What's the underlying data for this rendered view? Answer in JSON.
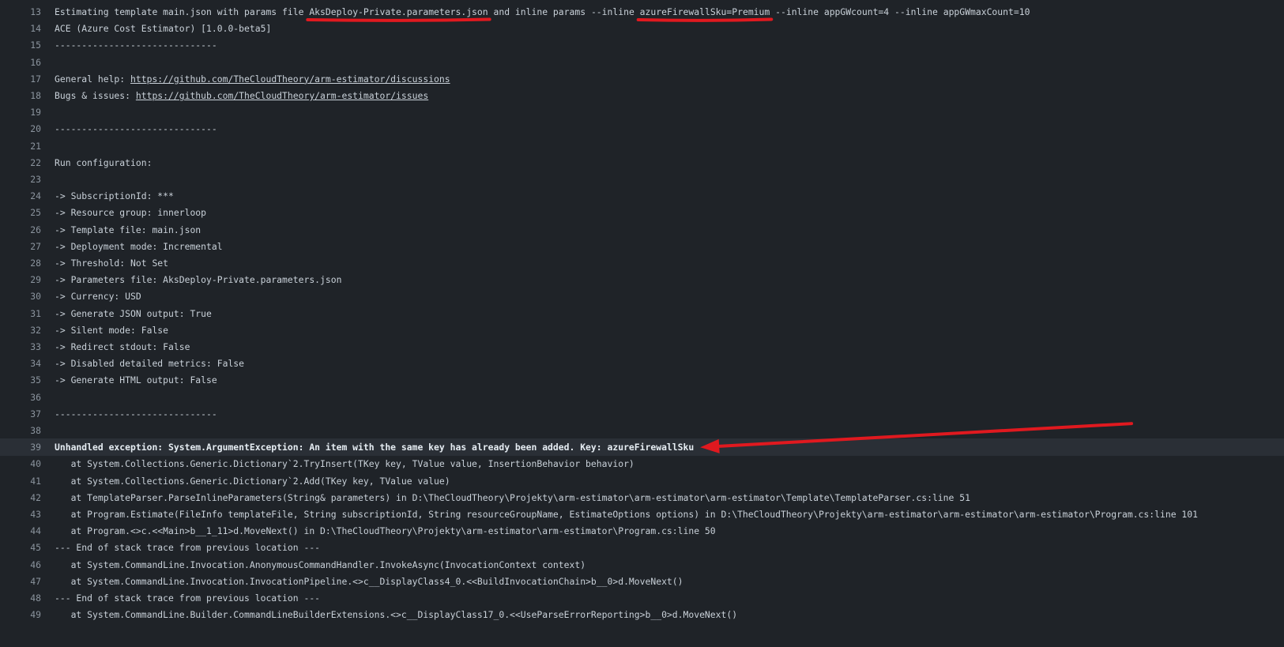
{
  "lines": [
    {
      "num": "13",
      "parts": [
        {
          "t": "Estimating template main.json with params file "
        },
        {
          "t": "AksDeploy-Private.parameters.json",
          "mark": "underline1"
        },
        {
          "t": " and inline params --inline "
        },
        {
          "t": "azureFirewallSku=Premium",
          "mark": "underline2"
        },
        {
          "t": " --inline appGWcount=4 --inline appGWmaxCount=10"
        }
      ]
    },
    {
      "num": "14",
      "parts": [
        {
          "t": "ACE (Azure Cost Estimator) [1.0.0-beta5]"
        }
      ]
    },
    {
      "num": "15",
      "parts": [
        {
          "t": "------------------------------"
        }
      ]
    },
    {
      "num": "16",
      "parts": []
    },
    {
      "num": "17",
      "parts": [
        {
          "t": "General help: "
        },
        {
          "t": "https://github.com/TheCloudTheory/arm-estimator/discussions",
          "link": true
        }
      ]
    },
    {
      "num": "18",
      "parts": [
        {
          "t": "Bugs & issues: "
        },
        {
          "t": "https://github.com/TheCloudTheory/arm-estimator/issues",
          "link": true
        }
      ]
    },
    {
      "num": "19",
      "parts": []
    },
    {
      "num": "20",
      "parts": [
        {
          "t": "------------------------------"
        }
      ]
    },
    {
      "num": "21",
      "parts": []
    },
    {
      "num": "22",
      "parts": [
        {
          "t": "Run configuration:"
        }
      ]
    },
    {
      "num": "23",
      "parts": []
    },
    {
      "num": "24",
      "parts": [
        {
          "t": "-> SubscriptionId: ***"
        }
      ]
    },
    {
      "num": "25",
      "parts": [
        {
          "t": "-> Resource group: innerloop"
        }
      ]
    },
    {
      "num": "26",
      "parts": [
        {
          "t": "-> Template file: main.json"
        }
      ]
    },
    {
      "num": "27",
      "parts": [
        {
          "t": "-> Deployment mode: Incremental"
        }
      ]
    },
    {
      "num": "28",
      "parts": [
        {
          "t": "-> Threshold: Not Set"
        }
      ]
    },
    {
      "num": "29",
      "parts": [
        {
          "t": "-> Parameters file: AksDeploy-Private.parameters.json"
        }
      ]
    },
    {
      "num": "30",
      "parts": [
        {
          "t": "-> Currency: USD"
        }
      ]
    },
    {
      "num": "31",
      "parts": [
        {
          "t": "-> Generate JSON output: True"
        }
      ]
    },
    {
      "num": "32",
      "parts": [
        {
          "t": "-> Silent mode: False"
        }
      ]
    },
    {
      "num": "33",
      "parts": [
        {
          "t": "-> Redirect stdout: False"
        }
      ]
    },
    {
      "num": "34",
      "parts": [
        {
          "t": "-> Disabled detailed metrics: False"
        }
      ]
    },
    {
      "num": "35",
      "parts": [
        {
          "t": "-> Generate HTML output: False"
        }
      ]
    },
    {
      "num": "36",
      "parts": []
    },
    {
      "num": "37",
      "parts": [
        {
          "t": "------------------------------"
        }
      ]
    },
    {
      "num": "38",
      "parts": []
    },
    {
      "num": "39",
      "highlight": true,
      "parts": [
        {
          "t": "Unhandled exception: System.ArgumentException: An item with the same key has already been added. Key: azureFirewallSku",
          "mark": "arrow-target"
        }
      ]
    },
    {
      "num": "40",
      "parts": [
        {
          "t": "   at System.Collections.Generic.Dictionary`2.TryInsert(TKey key, TValue value, InsertionBehavior behavior)"
        }
      ]
    },
    {
      "num": "41",
      "parts": [
        {
          "t": "   at System.Collections.Generic.Dictionary`2.Add(TKey key, TValue value)"
        }
      ]
    },
    {
      "num": "42",
      "parts": [
        {
          "t": "   at TemplateParser.ParseInlineParameters(String& parameters) in D:\\TheCloudTheory\\Projekty\\arm-estimator\\arm-estimator\\arm-estimator\\Template\\TemplateParser.cs:line 51"
        }
      ]
    },
    {
      "num": "43",
      "parts": [
        {
          "t": "   at Program.Estimate(FileInfo templateFile, String subscriptionId, String resourceGroupName, EstimateOptions options) in D:\\TheCloudTheory\\Projekty\\arm-estimator\\arm-estimator\\arm-estimator\\Program.cs:line 101"
        }
      ]
    },
    {
      "num": "44",
      "parts": [
        {
          "t": "   at Program.<>c.<<Main>b__1_11>d.MoveNext() in D:\\TheCloudTheory\\Projekty\\arm-estimator\\arm-estimator\\Program.cs:line 50"
        }
      ]
    },
    {
      "num": "45",
      "parts": [
        {
          "t": "--- End of stack trace from previous location ---"
        }
      ]
    },
    {
      "num": "46",
      "parts": [
        {
          "t": "   at System.CommandLine.Invocation.AnonymousCommandHandler.InvokeAsync(InvocationContext context)"
        }
      ]
    },
    {
      "num": "47",
      "parts": [
        {
          "t": "   at System.CommandLine.Invocation.InvocationPipeline.<>c__DisplayClass4_0.<<BuildInvocationChain>b__0>d.MoveNext()"
        }
      ]
    },
    {
      "num": "48",
      "parts": [
        {
          "t": "--- End of stack trace from previous location ---"
        }
      ]
    },
    {
      "num": "49",
      "parts": [
        {
          "t": "   at System.CommandLine.Builder.CommandLineBuilderExtensions.<>c__DisplayClass17_0.<<UseParseErrorReporting>b__0>d.MoveNext()"
        }
      ]
    }
  ],
  "colors": {
    "background": "#1f2328",
    "highlight_row": "#2a2f36",
    "text": "#c9d1d9",
    "line_number": "#8b949e",
    "annotation": "#e0191f"
  }
}
